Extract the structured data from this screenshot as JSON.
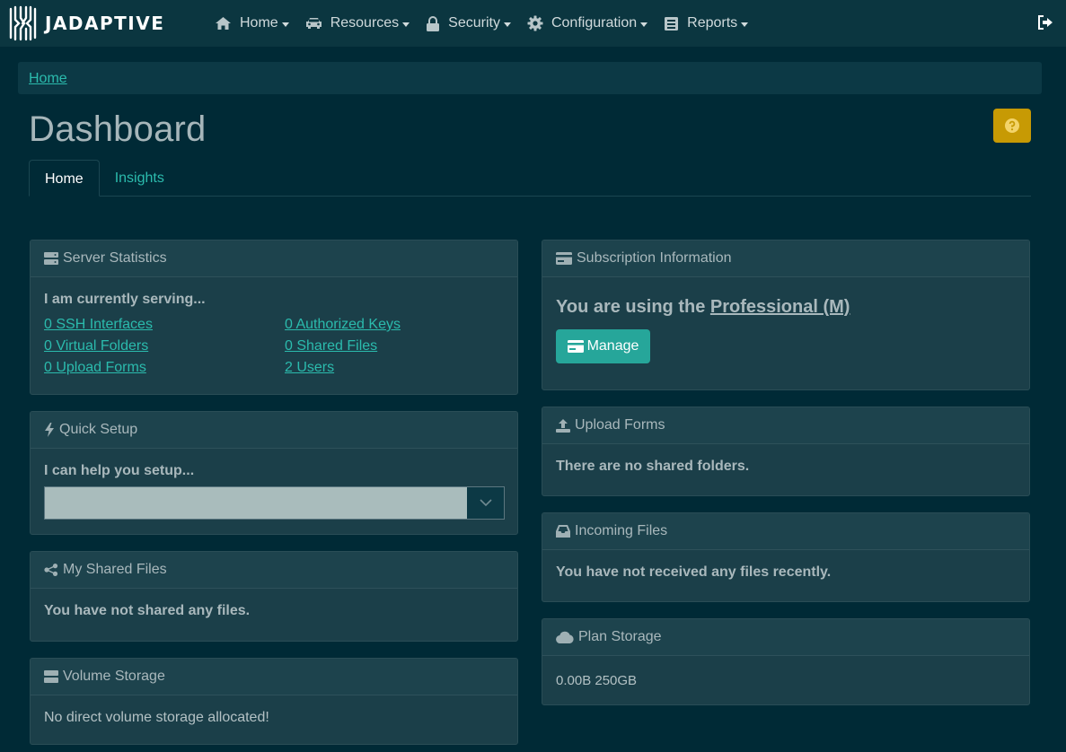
{
  "brand": {
    "name": "JADAPTIVE"
  },
  "nav": {
    "items": [
      {
        "label": "Home",
        "icon": "home-icon"
      },
      {
        "label": "Resources",
        "icon": "car-icon"
      },
      {
        "label": "Security",
        "icon": "lock-icon"
      },
      {
        "label": "Configuration",
        "icon": "gear-icon"
      },
      {
        "label": "Reports",
        "icon": "report-icon"
      }
    ],
    "logout_icon": "sign-out-icon"
  },
  "breadcrumb": {
    "home": "Home"
  },
  "page": {
    "title": "Dashboard",
    "help_icon": "question-circle-icon"
  },
  "tabs": [
    {
      "label": "Home",
      "active": true
    },
    {
      "label": "Insights",
      "active": false
    }
  ],
  "server_statistics": {
    "title": "Server Statistics",
    "intro": "I am currently serving...",
    "links": [
      "0 SSH Interfaces",
      "0 Authorized Keys",
      "0 Virtual Folders",
      "0 Shared Files",
      "0 Upload Forms",
      "2 Users"
    ]
  },
  "quick_setup": {
    "title": "Quick Setup",
    "intro": "I can help you setup...",
    "select_value": ""
  },
  "my_shared_files": {
    "title": "My Shared Files",
    "message": "You have not shared any files."
  },
  "volume_storage": {
    "title": "Volume Storage",
    "message": "No direct volume storage allocated!"
  },
  "subscription": {
    "title": "Subscription Information",
    "prefix": "You are using the ",
    "plan": "Professional (M)",
    "manage_label": "Manage"
  },
  "upload_forms": {
    "title": "Upload Forms",
    "message": "There are no shared folders."
  },
  "incoming_files": {
    "title": "Incoming Files",
    "message": "You have not received any files recently."
  },
  "plan_storage": {
    "title": "Plan Storage",
    "value": "0.00B 250GB"
  },
  "colors": {
    "background": "#002a36",
    "navbar": "#0b3640",
    "card": "#1b3f49",
    "accent": "#2bbbad",
    "button": "#26a69a",
    "help": "#c79a04"
  }
}
